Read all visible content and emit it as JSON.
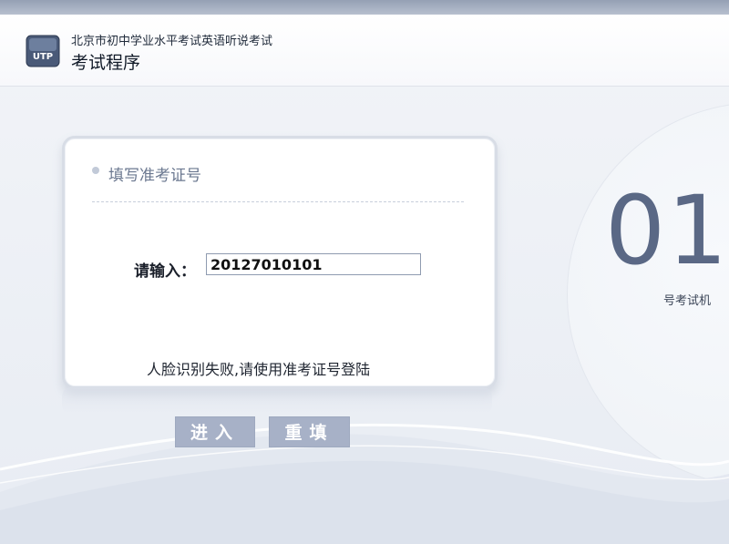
{
  "header": {
    "logo_text": "UTP",
    "subtitle": "北京市初中学业水平考试英语听说考试",
    "title": "考试程序"
  },
  "card": {
    "heading": "填写准考证号",
    "input_label": "请输入：",
    "input_value": "20127010101",
    "notice": "人脸识别失败,请使用准考证号登陆"
  },
  "buttons": {
    "enter": "进入",
    "reset": "重填"
  },
  "seat": {
    "number": "01",
    "label": "号考试机"
  },
  "colors": {
    "accent": "#a7b1c7",
    "seat_number": "#5a6885",
    "top_strip": "#95a0b4"
  },
  "icons": [
    "utp-logo-icon",
    "bullet-dot-icon"
  ]
}
